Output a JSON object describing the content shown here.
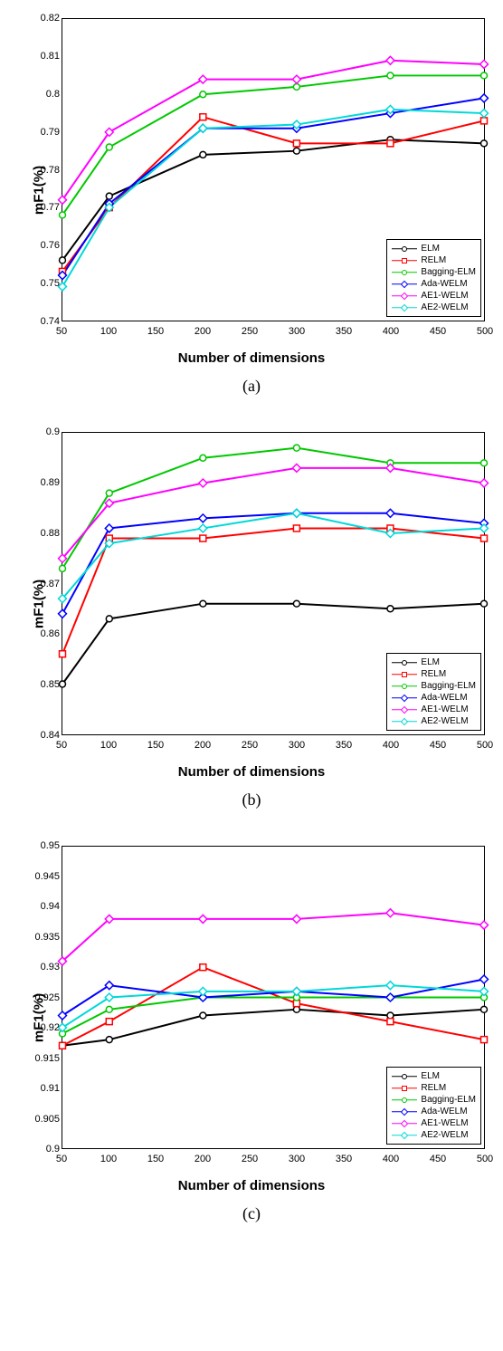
{
  "sublabels": {
    "a": "(a)",
    "b": "(b)",
    "c": "(c)"
  },
  "legend": [
    {
      "name": "ELM",
      "color": "#000000"
    },
    {
      "name": "RELM",
      "color": "#ff0000"
    },
    {
      "name": "Bagging-ELM",
      "color": "#00c800"
    },
    {
      "name": "Ada-WELM",
      "color": "#0000ff"
    },
    {
      "name": "AE1-WELM",
      "color": "#ff00ff"
    },
    {
      "name": "AE2-WELM",
      "color": "#00d8d8"
    }
  ],
  "chart_data": [
    {
      "type": "line",
      "xlabel": "Number of dimensions",
      "ylabel": "mF1(%)",
      "x": [
        50,
        100,
        200,
        300,
        400,
        500
      ],
      "xlim": [
        50,
        500
      ],
      "ylim": [
        0.74,
        0.82
      ],
      "xticks": [
        50,
        100,
        150,
        200,
        250,
        300,
        350,
        400,
        450,
        500
      ],
      "yticks": [
        0.74,
        0.75,
        0.76,
        0.77,
        0.78,
        0.79,
        0.8,
        0.81,
        0.82
      ],
      "series": [
        {
          "name": "ELM",
          "color": "#000000",
          "marker": "circle",
          "values": [
            0.756,
            0.773,
            0.784,
            0.785,
            0.788,
            0.787
          ]
        },
        {
          "name": "RELM",
          "color": "#ff0000",
          "marker": "square",
          "values": [
            0.753,
            0.77,
            0.794,
            0.787,
            0.787,
            0.793
          ]
        },
        {
          "name": "Bagging-ELM",
          "color": "#00c800",
          "marker": "circle",
          "values": [
            0.768,
            0.786,
            0.8,
            0.802,
            0.805,
            0.805
          ]
        },
        {
          "name": "Ada-WELM",
          "color": "#0000ff",
          "marker": "diamond",
          "values": [
            0.752,
            0.771,
            0.791,
            0.791,
            0.795,
            0.799
          ]
        },
        {
          "name": "AE1-WELM",
          "color": "#ff00ff",
          "marker": "diamond",
          "values": [
            0.772,
            0.79,
            0.804,
            0.804,
            0.809,
            0.808
          ]
        },
        {
          "name": "AE2-WELM",
          "color": "#00d8d8",
          "marker": "diamond",
          "values": [
            0.749,
            0.77,
            0.791,
            0.792,
            0.796,
            0.795
          ]
        }
      ]
    },
    {
      "type": "line",
      "xlabel": "Number of dimensions",
      "ylabel": "mF1(%)",
      "x": [
        50,
        100,
        200,
        300,
        400,
        500
      ],
      "xlim": [
        50,
        500
      ],
      "ylim": [
        0.84,
        0.9
      ],
      "xticks": [
        50,
        100,
        150,
        200,
        250,
        300,
        350,
        400,
        450,
        500
      ],
      "yticks": [
        0.84,
        0.85,
        0.86,
        0.87,
        0.88,
        0.89,
        0.9
      ],
      "series": [
        {
          "name": "ELM",
          "color": "#000000",
          "marker": "circle",
          "values": [
            0.85,
            0.863,
            0.866,
            0.866,
            0.865,
            0.866
          ]
        },
        {
          "name": "RELM",
          "color": "#ff0000",
          "marker": "square",
          "values": [
            0.856,
            0.879,
            0.879,
            0.881,
            0.881,
            0.879
          ]
        },
        {
          "name": "Bagging-ELM",
          "color": "#00c800",
          "marker": "circle",
          "values": [
            0.873,
            0.888,
            0.895,
            0.897,
            0.894,
            0.894
          ]
        },
        {
          "name": "Ada-WELM",
          "color": "#0000ff",
          "marker": "diamond",
          "values": [
            0.864,
            0.881,
            0.883,
            0.884,
            0.884,
            0.882
          ]
        },
        {
          "name": "AE1-WELM",
          "color": "#ff00ff",
          "marker": "diamond",
          "values": [
            0.875,
            0.886,
            0.89,
            0.893,
            0.893,
            0.89
          ]
        },
        {
          "name": "AE2-WELM",
          "color": "#00d8d8",
          "marker": "diamond",
          "values": [
            0.867,
            0.878,
            0.881,
            0.884,
            0.88,
            0.881
          ]
        }
      ]
    },
    {
      "type": "line",
      "xlabel": "Number of dimensions",
      "ylabel": "mF1(%)",
      "x": [
        50,
        100,
        200,
        300,
        400,
        500
      ],
      "xlim": [
        50,
        500
      ],
      "ylim": [
        0.9,
        0.95
      ],
      "xticks": [
        50,
        100,
        150,
        200,
        250,
        300,
        350,
        400,
        450,
        500
      ],
      "yticks": [
        0.9,
        0.905,
        0.91,
        0.915,
        0.92,
        0.925,
        0.93,
        0.935,
        0.94,
        0.945,
        0.95
      ],
      "series": [
        {
          "name": "ELM",
          "color": "#000000",
          "marker": "circle",
          "values": [
            0.917,
            0.918,
            0.922,
            0.923,
            0.922,
            0.923
          ]
        },
        {
          "name": "RELM",
          "color": "#ff0000",
          "marker": "square",
          "values": [
            0.917,
            0.921,
            0.93,
            0.924,
            0.921,
            0.918
          ]
        },
        {
          "name": "Bagging-ELM",
          "color": "#00c800",
          "marker": "circle",
          "values": [
            0.919,
            0.923,
            0.925,
            0.925,
            0.925,
            0.925
          ]
        },
        {
          "name": "Ada-WELM",
          "color": "#0000ff",
          "marker": "diamond",
          "values": [
            0.922,
            0.927,
            0.925,
            0.926,
            0.925,
            0.928
          ]
        },
        {
          "name": "AE1-WELM",
          "color": "#ff00ff",
          "marker": "diamond",
          "values": [
            0.931,
            0.938,
            0.938,
            0.938,
            0.939,
            0.937
          ]
        },
        {
          "name": "AE2-WELM",
          "color": "#00d8d8",
          "marker": "diamond",
          "values": [
            0.92,
            0.925,
            0.926,
            0.926,
            0.927,
            0.926
          ]
        }
      ]
    }
  ]
}
